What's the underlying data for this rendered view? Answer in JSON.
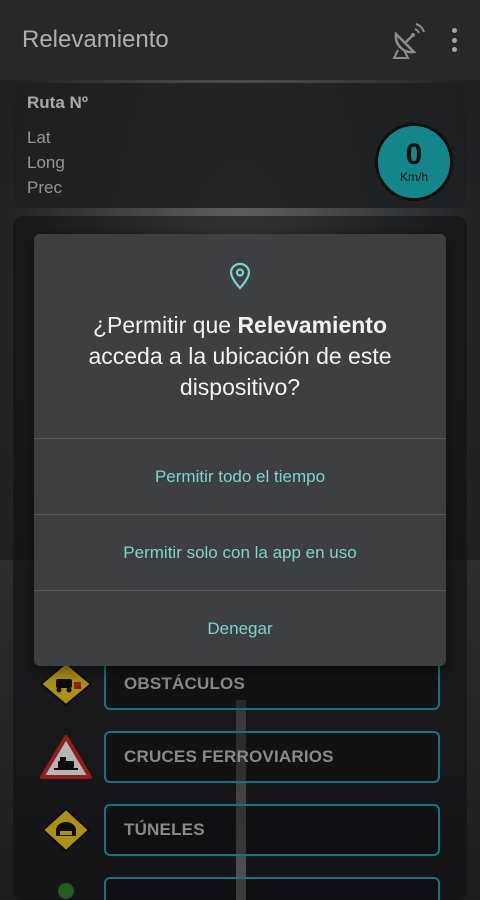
{
  "app": {
    "title": "Relevamiento"
  },
  "info": {
    "ruta_label": "Ruta Nº",
    "lat_label": "Lat",
    "long_label": "Long",
    "prec_label": "Prec",
    "speed_value": "0",
    "speed_unit": "Km/h"
  },
  "categories": [
    {
      "label": "OBSTÁCULOS",
      "icon": "obstacle-sign-icon"
    },
    {
      "label": "CRUCES FERROVIARIOS",
      "icon": "railway-crossing-sign-icon"
    },
    {
      "label": "TÚNELES",
      "icon": "tunnel-sign-icon"
    }
  ],
  "dialog": {
    "title_prefix": "¿Permitir que ",
    "title_app": "Relevamiento",
    "title_suffix": " acceda a la ubicación de este dispositivo?",
    "options": [
      "Permitir todo el tiempo",
      "Permitir solo con la app en uso",
      "Denegar"
    ]
  },
  "colors": {
    "accent": "#7fd4cc",
    "speed_circle": "#19b3b8",
    "button_border": "#1e9ea8"
  }
}
